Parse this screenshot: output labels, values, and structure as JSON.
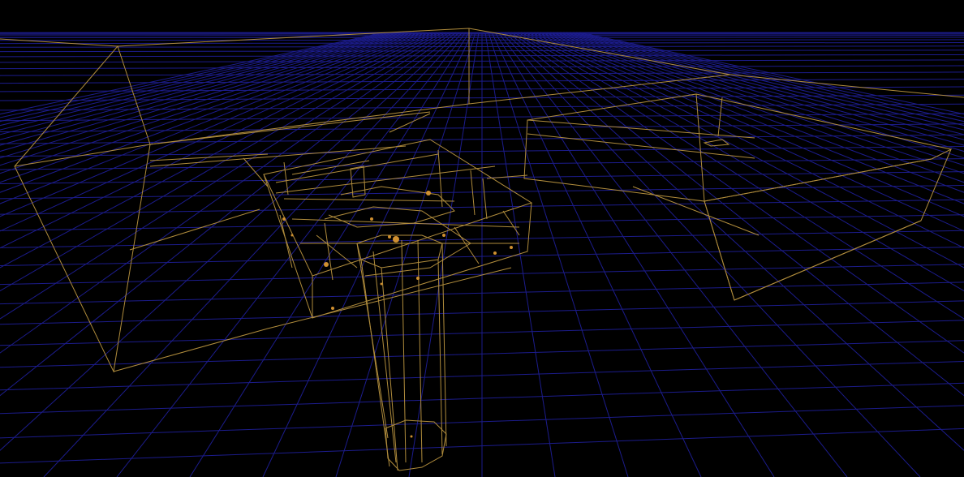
{
  "viewport": {
    "mode": "wireframe",
    "colors": {
      "background": "#000000",
      "grid": "#1c1c8c",
      "wireframe": "#b08c3c",
      "detail": "#d09030"
    }
  }
}
